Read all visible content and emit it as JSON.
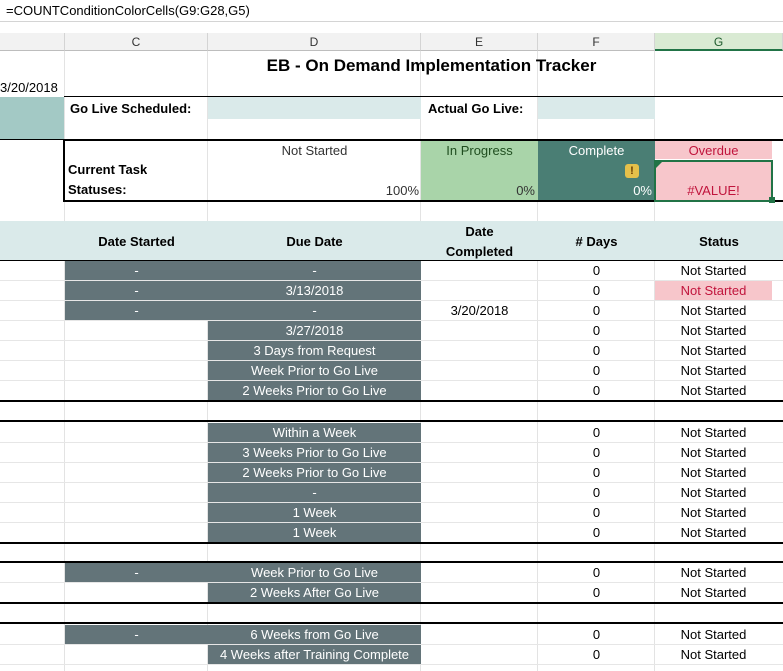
{
  "formula_bar": {
    "text": "=COUNTConditionColorCells(G9:G28,G5)"
  },
  "columns": [
    "C",
    "D",
    "E",
    "F",
    "G"
  ],
  "selected_column": "G",
  "date_label": "3/20/2018",
  "title": "EB - On Demand Implementation Tracker",
  "go_live": {
    "scheduled_label": "Go Live Scheduled:",
    "actual_label": "Actual Go Live:"
  },
  "statuses": {
    "label_line1": "Current Task",
    "label_line2": "Statuses:",
    "not_started": {
      "label": "Not Started",
      "value": "100%"
    },
    "in_progress": {
      "label": "In Progress",
      "value": "0%"
    },
    "complete": {
      "label": "Complete",
      "value": "0%"
    },
    "overdue": {
      "label": "Overdue",
      "value": "#VALUE!"
    }
  },
  "headers": {
    "date_started": "Date Started",
    "due_date": "Due Date",
    "date_completed_line1": "Date",
    "date_completed_line2": "Completed",
    "days": "# Days",
    "status": "Status"
  },
  "rows": [
    {
      "started": "-",
      "due": "-",
      "completed": "",
      "days": "0",
      "status": "Not Started"
    },
    {
      "started": "-",
      "due": "3/13/2018",
      "completed": "",
      "days": "0",
      "status": "Not Started"
    },
    {
      "started": "-",
      "due": "-",
      "completed": "3/20/2018",
      "days": "0",
      "status": "Not Started"
    },
    {
      "started": "",
      "due": "3/27/2018",
      "completed": "",
      "days": "0",
      "status": "Not Started"
    },
    {
      "started": "",
      "due": "3 Days from Request",
      "completed": "",
      "days": "0",
      "status": "Not Started"
    },
    {
      "started": "",
      "due": "Week Prior to Go Live",
      "completed": "",
      "days": "0",
      "status": "Not Started"
    },
    {
      "started": "",
      "due": "2 Weeks Prior to Go Live",
      "completed": "",
      "days": "0",
      "status": "Not Started"
    },
    {
      "started": "",
      "due": "Within a Week",
      "completed": "",
      "days": "0",
      "status": "Not Started"
    },
    {
      "started": "",
      "due": "3 Weeks Prior to Go Live",
      "completed": "",
      "days": "0",
      "status": "Not Started"
    },
    {
      "started": "",
      "due": "2 Weeks Prior to Go Live",
      "completed": "",
      "days": "0",
      "status": "Not Started"
    },
    {
      "started": "",
      "due": "-",
      "completed": "",
      "days": "0",
      "status": "Not Started"
    },
    {
      "started": "",
      "due": "1 Week",
      "completed": "",
      "days": "0",
      "status": "Not Started"
    },
    {
      "started": "",
      "due": "1 Week",
      "completed": "",
      "days": "0",
      "status": "Not Started"
    },
    {
      "started": "-",
      "due": "Week Prior to Go Live",
      "completed": "",
      "days": "0",
      "status": "Not Started"
    },
    {
      "started": "",
      "due": "2 Weeks After Go Live",
      "completed": "",
      "days": "0",
      "status": "Not Started"
    },
    {
      "started": "-",
      "due": "6 Weeks from Go Live",
      "completed": "",
      "days": "0",
      "status": "Not Started"
    },
    {
      "started": "",
      "due": "4 Weeks after Training Complete",
      "completed": "",
      "days": "0",
      "status": "Not Started"
    }
  ],
  "colors": {
    "dark_cell": "#637479",
    "teal_light": "#daeaea",
    "in_progress": "#a9d4a9",
    "complete": "#4a7e74",
    "overdue": "#f7c6cb",
    "overdue_text": "#c0143c"
  }
}
